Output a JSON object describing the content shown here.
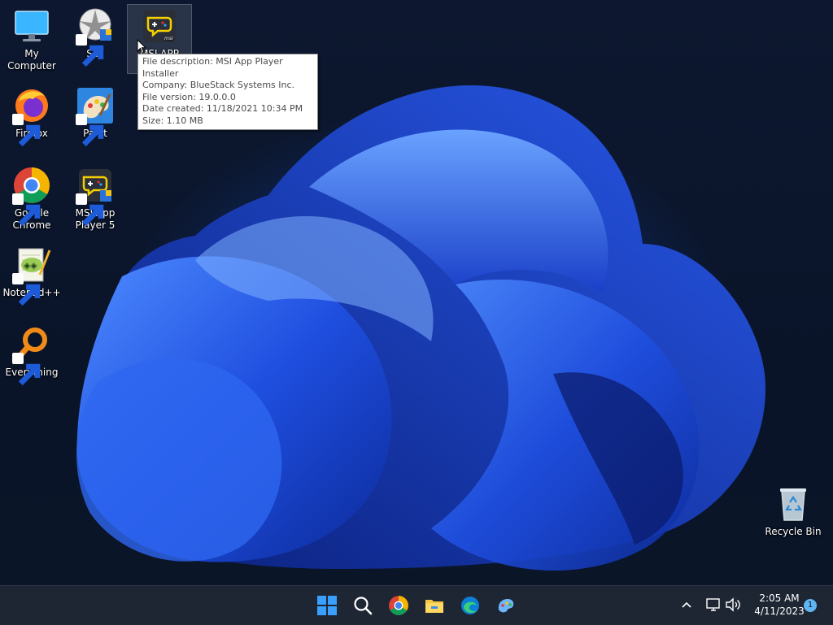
{
  "desktop_icons": [
    {
      "label": "My Computer",
      "icon": "monitor-icon",
      "shortcut": false
    },
    {
      "label": "SIM",
      "icon": "sim-icon",
      "shortcut": true
    },
    {
      "label": "MSI APP",
      "icon": "msi-app-player-installer-icon",
      "shortcut": false,
      "selected": true
    },
    {
      "label": "Firefox",
      "icon": "firefox-icon",
      "shortcut": true
    },
    {
      "label": "Paint",
      "icon": "paint-icon",
      "shortcut": true
    },
    {
      "label": "Google Chrome",
      "icon": "chrome-icon",
      "shortcut": true
    },
    {
      "label": "MSI App Player 5",
      "icon": "msi-app-player-icon",
      "shortcut": true
    },
    {
      "label": "Notepad++",
      "icon": "notepad-plus-plus-icon",
      "shortcut": true
    },
    {
      "label": "Everything",
      "icon": "everything-search-icon",
      "shortcut": true
    },
    {
      "label": "Recycle Bin",
      "icon": "recycle-bin-icon",
      "shortcut": false
    }
  ],
  "tooltip": {
    "lines": [
      "File description: MSI App Player Installer",
      "Company: BlueStack Systems Inc.",
      "File version: 19.0.0.0",
      "Date created: 11/18/2021 10:34 PM",
      "Size: 1.10 MB"
    ]
  },
  "taskbar": {
    "pinned": [
      {
        "name": "start-button",
        "icon": "windows-logo-icon"
      },
      {
        "name": "search-button",
        "icon": "search-icon"
      },
      {
        "name": "chrome-taskbar-button",
        "icon": "chrome-icon"
      },
      {
        "name": "file-explorer-taskbar-button",
        "icon": "folder-icon"
      },
      {
        "name": "edge-taskbar-button",
        "icon": "edge-icon"
      },
      {
        "name": "paint-taskbar-button",
        "icon": "paint-icon"
      }
    ],
    "clock": {
      "time": "2:05 AM",
      "date": "4/11/2023"
    },
    "notification_count": "1"
  }
}
